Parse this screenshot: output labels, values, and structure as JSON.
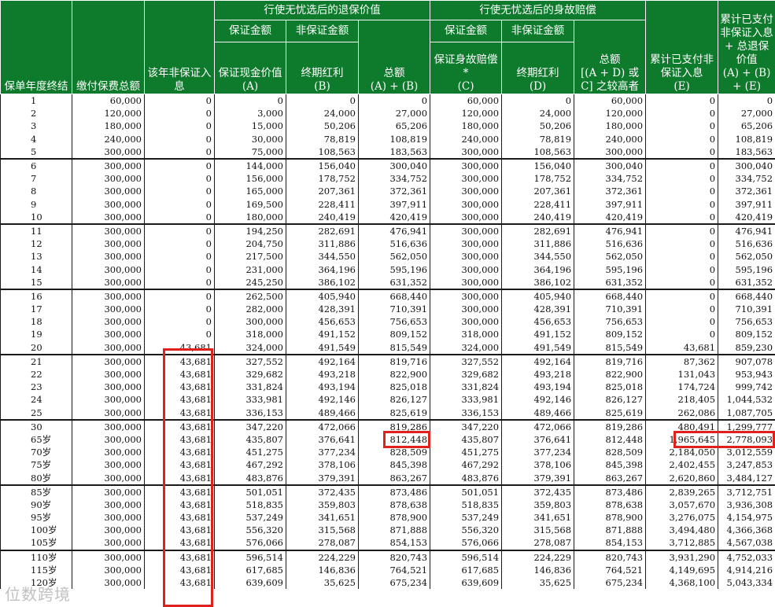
{
  "headers": {
    "col_year": "保单年度终结",
    "col_premium": "缴付保费总额",
    "col_annual_nonguar": "该年非保证入息",
    "group_surrender": "行使无忧选后的退保价值",
    "group_death": "行使无忧选后的身故赔偿",
    "sub_guaranteed": "保证金额",
    "sub_nonguaranteed": "非保证金额",
    "sub_nonguaranteed_2": "非保证金额",
    "sub_guaranteed_2": "保证金额",
    "cash_value": "保证现金价值",
    "cash_value_label": "(A)",
    "terminal_bonus": "终期红利",
    "terminal_bonus_label": "(B)",
    "total": "总额",
    "total_label": "(A) + (B)",
    "death_guaranteed": "保证身故赔偿*",
    "death_guaranteed_label": "(C)",
    "death_terminal_bonus": "终期红利",
    "death_terminal_bonus_label": "(D)",
    "death_total": "总额",
    "death_total_label": "[(A + D) 或 C] 之较高者",
    "cumulative_paid": "累计已支付非保证入息",
    "cumulative_paid_label": "(E)",
    "cumulative_total": "累计已支付非保证入息 + 总退保价值",
    "cumulative_total_label": "(A) + (B) + (E)"
  },
  "rows": [
    [
      "1",
      "60,000",
      "0",
      "0",
      "0",
      "0",
      "60,000",
      "0",
      "60,000",
      "0",
      "0"
    ],
    [
      "2",
      "120,000",
      "0",
      "3,000",
      "24,000",
      "27,000",
      "120,000",
      "24,000",
      "120,000",
      "0",
      "27,000"
    ],
    [
      "3",
      "180,000",
      "0",
      "15,000",
      "50,206",
      "65,206",
      "180,000",
      "50,206",
      "180,000",
      "0",
      "65,206"
    ],
    [
      "4",
      "240,000",
      "0",
      "30,000",
      "78,819",
      "108,819",
      "240,000",
      "78,819",
      "240,000",
      "0",
      "108,819"
    ],
    [
      "5",
      "300,000",
      "0",
      "75,000",
      "108,563",
      "183,563",
      "300,000",
      "108,563",
      "300,000",
      "0",
      "183,563"
    ],
    [
      "6",
      "300,000",
      "0",
      "144,000",
      "156,040",
      "300,040",
      "300,000",
      "156,040",
      "300,040",
      "0",
      "300,040"
    ],
    [
      "7",
      "300,000",
      "0",
      "156,000",
      "178,752",
      "334,752",
      "300,000",
      "178,752",
      "334,752",
      "0",
      "334,752"
    ],
    [
      "8",
      "300,000",
      "0",
      "165,000",
      "207,361",
      "372,361",
      "300,000",
      "207,361",
      "372,361",
      "0",
      "372,361"
    ],
    [
      "9",
      "300,000",
      "0",
      "169,500",
      "228,411",
      "397,911",
      "300,000",
      "228,411",
      "397,911",
      "0",
      "397,911"
    ],
    [
      "10",
      "300,000",
      "0",
      "180,000",
      "240,419",
      "420,419",
      "300,000",
      "240,419",
      "420,419",
      "0",
      "420,419"
    ],
    [
      "11",
      "300,000",
      "0",
      "194,250",
      "282,691",
      "476,941",
      "300,000",
      "282,691",
      "476,941",
      "0",
      "476,941"
    ],
    [
      "12",
      "300,000",
      "0",
      "204,750",
      "311,886",
      "516,636",
      "300,000",
      "311,886",
      "516,636",
      "0",
      "516,636"
    ],
    [
      "13",
      "300,000",
      "0",
      "217,500",
      "344,550",
      "562,050",
      "300,000",
      "344,550",
      "562,050",
      "0",
      "562,050"
    ],
    [
      "14",
      "300,000",
      "0",
      "231,000",
      "364,196",
      "595,196",
      "300,000",
      "364,196",
      "595,196",
      "0",
      "595,196"
    ],
    [
      "15",
      "300,000",
      "0",
      "245,250",
      "386,102",
      "631,352",
      "300,000",
      "386,102",
      "631,352",
      "0",
      "631,352"
    ],
    [
      "16",
      "300,000",
      "0",
      "262,500",
      "405,940",
      "668,440",
      "300,000",
      "405,940",
      "668,440",
      "0",
      "668,440"
    ],
    [
      "17",
      "300,000",
      "0",
      "282,000",
      "428,391",
      "710,391",
      "300,000",
      "428,391",
      "710,391",
      "0",
      "710,391"
    ],
    [
      "18",
      "300,000",
      "0",
      "300,000",
      "456,653",
      "756,653",
      "300,000",
      "456,653",
      "756,653",
      "0",
      "756,653"
    ],
    [
      "19",
      "300,000",
      "0",
      "318,000",
      "491,152",
      "809,152",
      "318,000",
      "491,152",
      "809,152",
      "0",
      "809,152"
    ],
    [
      "20",
      "300,000",
      "43,681",
      "324,000",
      "491,549",
      "815,549",
      "324,000",
      "491,549",
      "815,549",
      "43,681",
      "859,230"
    ],
    [
      "21",
      "300,000",
      "43,681",
      "327,552",
      "492,164",
      "819,716",
      "327,552",
      "492,164",
      "819,716",
      "87,362",
      "907,078"
    ],
    [
      "22",
      "300,000",
      "43,681",
      "329,682",
      "493,218",
      "822,900",
      "329,682",
      "493,218",
      "822,900",
      "131,043",
      "953,943"
    ],
    [
      "23",
      "300,000",
      "43,681",
      "331,824",
      "493,194",
      "825,018",
      "331,824",
      "493,194",
      "825,018",
      "174,724",
      "999,742"
    ],
    [
      "24",
      "300,000",
      "43,681",
      "333,981",
      "492,146",
      "826,127",
      "333,981",
      "492,146",
      "826,127",
      "218,405",
      "1,044,532"
    ],
    [
      "25",
      "300,000",
      "43,681",
      "336,153",
      "489,466",
      "825,619",
      "336,153",
      "489,466",
      "825,619",
      "262,086",
      "1,087,705"
    ],
    [
      "30",
      "300,000",
      "43,681",
      "347,220",
      "472,066",
      "819,286",
      "347,220",
      "472,066",
      "819,286",
      "480,491",
      "1,299,777"
    ],
    [
      "65岁",
      "300,000",
      "43,681",
      "435,807",
      "376,641",
      "812,448",
      "435,807",
      "376,641",
      "812,448",
      "1,965,645",
      "2,778,093"
    ],
    [
      "70岁",
      "300,000",
      "43,681",
      "451,275",
      "377,234",
      "828,509",
      "451,275",
      "377,234",
      "828,509",
      "2,184,050",
      "3,012,559"
    ],
    [
      "75岁",
      "300,000",
      "43,681",
      "467,292",
      "378,106",
      "845,398",
      "467,292",
      "378,106",
      "845,398",
      "2,402,455",
      "3,247,853"
    ],
    [
      "80岁",
      "300,000",
      "43,681",
      "483,876",
      "379,391",
      "863,267",
      "483,876",
      "379,391",
      "863,267",
      "2,620,860",
      "3,484,127"
    ],
    [
      "85岁",
      "300,000",
      "43,681",
      "501,051",
      "372,435",
      "873,486",
      "501,051",
      "372,435",
      "873,486",
      "2,839,265",
      "3,712,751"
    ],
    [
      "90岁",
      "300,000",
      "43,681",
      "518,835",
      "359,803",
      "878,638",
      "518,835",
      "359,803",
      "878,638",
      "3,057,670",
      "3,936,308"
    ],
    [
      "95岁",
      "300,000",
      "43,681",
      "537,249",
      "341,651",
      "878,900",
      "537,249",
      "341,651",
      "878,900",
      "3,276,075",
      "4,154,975"
    ],
    [
      "100岁",
      "300,000",
      "43,681",
      "556,320",
      "315,568",
      "871,888",
      "556,320",
      "315,568",
      "871,888",
      "3,494,480",
      "4,366,368"
    ],
    [
      "105岁",
      "300,000",
      "43,681",
      "576,066",
      "278,087",
      "854,153",
      "576,066",
      "278,087",
      "854,153",
      "3,712,885",
      "4,567,038"
    ],
    [
      "110岁",
      "300,000",
      "43,681",
      "596,514",
      "224,229",
      "820,743",
      "596,514",
      "224,229",
      "820,743",
      "3,931,290",
      "4,752,033"
    ],
    [
      "115岁",
      "300,000",
      "43,681",
      "617,685",
      "146,836",
      "764,521",
      "617,685",
      "146,836",
      "764,521",
      "4,149,695",
      "4,914,216"
    ],
    [
      "120岁",
      "300,000",
      "43,681",
      "639,609",
      "35,625",
      "675,234",
      "639,609",
      "35,625",
      "675,234",
      "4,368,100",
      "5,043,334"
    ]
  ],
  "group_starts": [
    5,
    10,
    15,
    20,
    25,
    30,
    35
  ],
  "watermark": "位数跨境",
  "colors": {
    "header_bg": "#0e7a2c",
    "header_text": "#ffffff",
    "highlight": "#e0201c"
  }
}
